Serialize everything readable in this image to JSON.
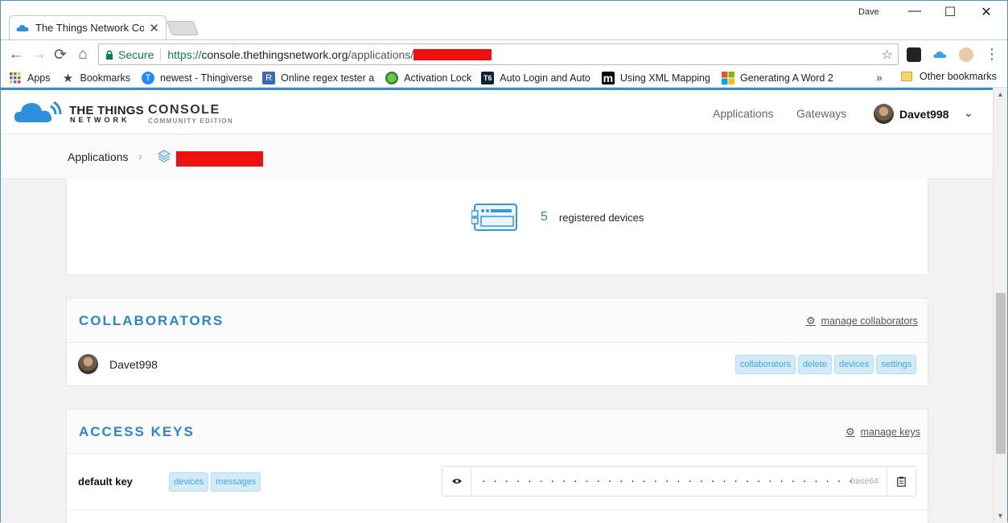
{
  "browser": {
    "tab_title": "The Things Network Con",
    "tab_close": "✕",
    "profile_name": "Dave",
    "window_controls": {
      "minimize": "—",
      "maximize": "☐",
      "close": "✕"
    },
    "nav": {
      "back": "←",
      "forward": "→",
      "reload": "⟳",
      "home": "⌂"
    },
    "secure_label": "Secure",
    "url_scheme": "https://",
    "url_host": "console.thethingsnetwork.org",
    "url_path": "/applications/",
    "star": "☆",
    "menu": "⋮",
    "bookmarks": [
      {
        "label": "Apps",
        "icon": "apps-grid-icon"
      },
      {
        "label": "Bookmarks",
        "icon": "star-icon"
      },
      {
        "label": "newest - Thingiverse",
        "icon": "thingiverse-icon"
      },
      {
        "label": "Online regex tester a",
        "icon": "regex-icon"
      },
      {
        "label": "Activation Lock",
        "icon": "globe-icon"
      },
      {
        "label": "Auto Login and Auto",
        "icon": "t6-icon"
      },
      {
        "label": "Using XML Mapping",
        "icon": "m-icon"
      },
      {
        "label": "Generating A Word 2",
        "icon": "windows-icon"
      }
    ],
    "bookmarks_more": "»",
    "other_bookmarks": "Other bookmarks"
  },
  "ttn": {
    "brand_main": "THE THINGS",
    "brand_sub": "NETWORK",
    "console_main": "CONSOLE",
    "console_sub": "COMMUNITY EDITION",
    "nav_applications": "Applications",
    "nav_gateways": "Gateways",
    "username": "Davet998",
    "chevron": "⌄"
  },
  "breadcrumb": {
    "applications": "Applications",
    "separator": "›"
  },
  "devices": {
    "count": "5",
    "label": "registered devices"
  },
  "collaborators": {
    "title": "COLLABORATORS",
    "action": "manage collaborators",
    "gear": "⚙",
    "members": [
      {
        "name": "Davet998",
        "rights": [
          "collaborators",
          "delete",
          "devices",
          "settings"
        ]
      }
    ]
  },
  "access_keys": {
    "title": "ACCESS KEYS",
    "action": "manage keys",
    "gear": "⚙",
    "keys": [
      {
        "name": "default key",
        "rights": [
          "devices",
          "messages"
        ],
        "masked_value": "· · · · · · · · · · · · · · · · · · · · · · · · · · · · · · · · · · · · · · · · · · · · · · · · · · · · · · · · · · · ·",
        "encoding": "base64"
      }
    ]
  },
  "colors": {
    "accent": "#2a86cc",
    "chip_bg": "#d1ebfb",
    "chip_text": "#4ba3dc",
    "secure_green": "#0b8043",
    "redaction": "#ee1111"
  }
}
